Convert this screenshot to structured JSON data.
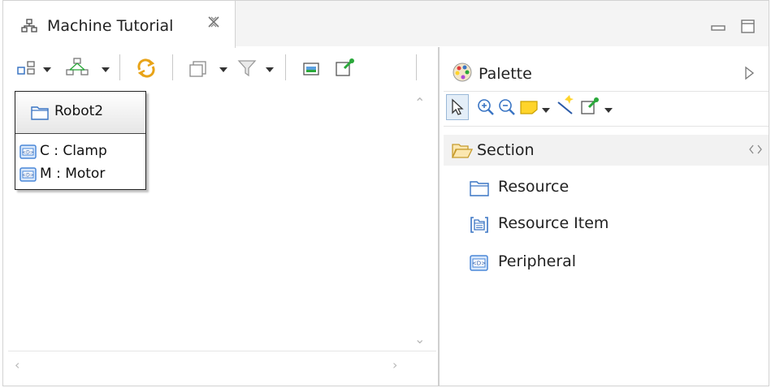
{
  "window": {
    "tab_title": "Machine Tutorial",
    "tab_icon": "diagram-icon",
    "close_icon": "close-icon",
    "minimize_icon": "minimize-icon",
    "maximize_icon": "maximize-icon"
  },
  "toolbar": {
    "items": [
      "layout-icon",
      "arrange-icon",
      "refresh-icon",
      "view-icon",
      "filter-icon",
      "export-image-icon",
      "pin-icon"
    ]
  },
  "diagram": {
    "node": {
      "title": "Robot2",
      "items": [
        {
          "label": "C : Clamp"
        },
        {
          "label": "M : Motor"
        }
      ]
    }
  },
  "palette": {
    "title": "Palette",
    "tools": [
      "select-icon",
      "zoom-in-icon",
      "zoom-out-icon",
      "note-icon",
      "connection-icon",
      "pin-tool-icon"
    ],
    "section_label": "Section",
    "entries": [
      {
        "label": "Resource"
      },
      {
        "label": "Resource Item"
      },
      {
        "label": "Peripheral"
      }
    ]
  },
  "colors": {
    "folder": "#3a75c4",
    "peripheral_blue": "#4a87d8",
    "note_yellow": "#ffd42a",
    "pin_green": "#2aa83a"
  }
}
